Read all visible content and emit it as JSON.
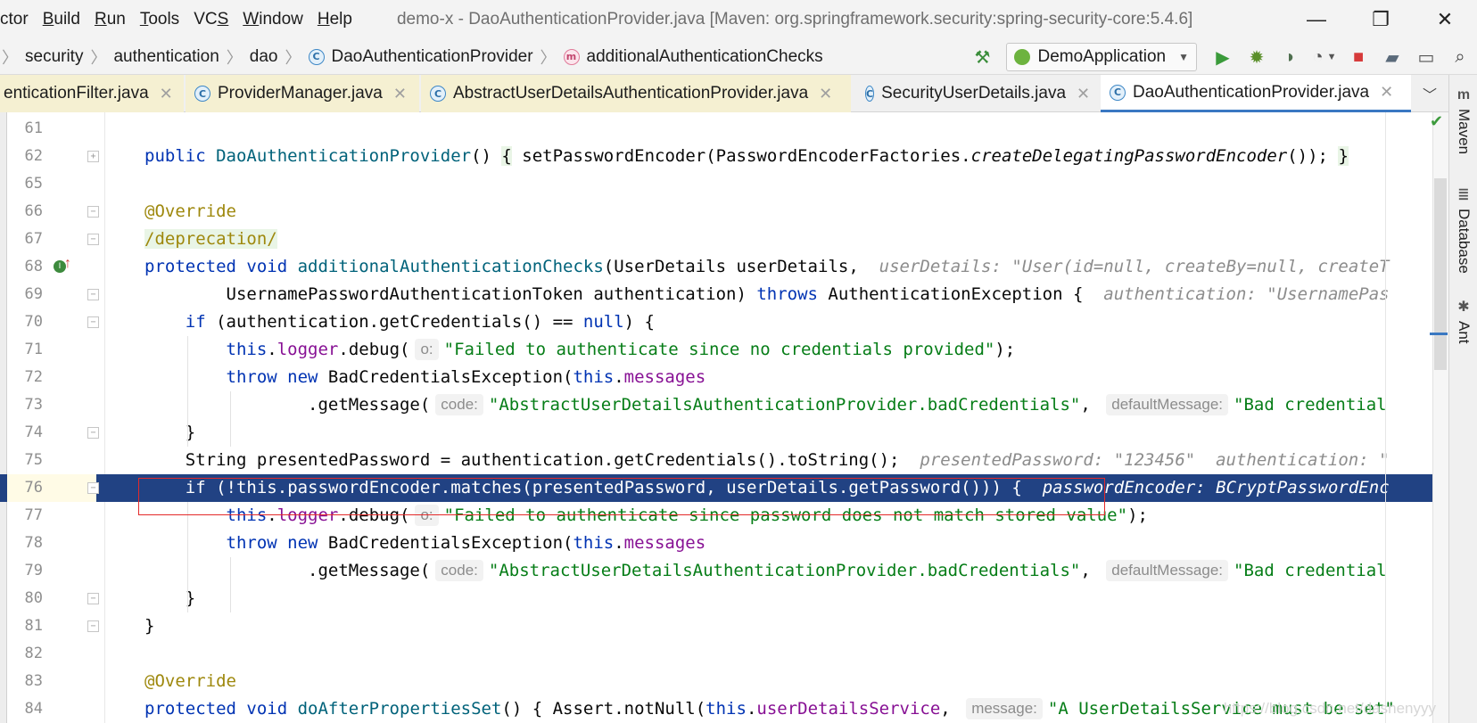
{
  "window": {
    "menu": [
      {
        "pre": "",
        "mn": "",
        "post": "ctor"
      },
      {
        "pre": "",
        "mn": "B",
        "post": "uild"
      },
      {
        "pre": "",
        "mn": "R",
        "post": "un"
      },
      {
        "pre": "",
        "mn": "T",
        "post": "ools"
      },
      {
        "pre": "VC",
        "mn": "S",
        "post": ""
      },
      {
        "pre": "",
        "mn": "W",
        "post": "indow"
      },
      {
        "pre": "",
        "mn": "H",
        "post": "elp"
      }
    ],
    "title": "demo-x - DaoAuthenticationProvider.java [Maven: org.springframework.security:spring-security-core:5.4.6]",
    "minimize": "—",
    "restore": "❐",
    "close": "✕"
  },
  "breadcrumbs": [
    "security",
    "authentication",
    "dao",
    "DaoAuthenticationProvider",
    "additionalAuthenticationChecks"
  ],
  "run_config": "DemoApplication",
  "tabs": [
    {
      "label": "enticationFilter.java",
      "style": "tan"
    },
    {
      "label": "ProviderManager.java",
      "style": "tan"
    },
    {
      "label": "AbstractUserDetailsAuthenticationProvider.java",
      "style": "tan"
    },
    {
      "label": "SecurityUserDetails.java",
      "style": "plain"
    },
    {
      "label": "DaoAuthenticationProvider.java",
      "style": "active"
    }
  ],
  "right_tools": [
    "Maven",
    "Database",
    "Ant"
  ],
  "editor": {
    "selected_line": "76",
    "lines": [
      {
        "n": "61",
        "html": ""
      },
      {
        "n": "62",
        "html": "<span class=\"kw\">public</span> <span class=\"fn\">DaoAuthenticationProvider</span>() <span class=\"brace-hl\">{</span> setPasswordEncoder(PasswordEncoderFactories.<span class=\"it\">createDelegatingPasswordEncoder</span>()); <span class=\"brace-hl\">}</span>"
      },
      {
        "n": "65",
        "html": ""
      },
      {
        "n": "66",
        "html": "<span class=\"ann\">@Override</span>"
      },
      {
        "n": "67",
        "html": "<span class=\"ann depr\">/deprecation/</span>"
      },
      {
        "n": "68",
        "html": "<span class=\"kw\">protected void</span> <span class=\"fn\">additionalAuthenticationChecks</span>(UserDetails userDetails,  <span class=\"hint\">userDetails: \"User(id=null, createBy=null, createT</span>"
      },
      {
        "n": "69",
        "html": "        UsernamePasswordAuthenticationToken authentication) <span class=\"kw\">throws</span> AuthenticationException {  <span class=\"hint\">authentication: \"UsernamePas</span>"
      },
      {
        "n": "70",
        "html": "    <span class=\"kw\">if</span> (authentication.getCredentials() == <span class=\"kw\">null</span>) {"
      },
      {
        "n": "71",
        "html": "        <span class=\"kw\">this</span>.<span class=\"fld\">logger</span>.debug(<span class=\"pill\">o:</span><span class=\"str\">\"Failed to authenticate since no credentials provided\"</span>);"
      },
      {
        "n": "72",
        "html": "        <span class=\"kw\">throw new</span> BadCredentialsException(<span class=\"kw\">this</span>.<span class=\"fld\">messages</span>"
      },
      {
        "n": "73",
        "html": "                .getMessage(<span class=\"pill\">code:</span><span class=\"str\">\"AbstractUserDetailsAuthenticationProvider.badCredentials\"</span>, <span class=\"pill\">defaultMessage:</span><span class=\"str\">\"Bad credential</span>"
      },
      {
        "n": "74",
        "html": "    }"
      },
      {
        "n": "75",
        "html": "    String presentedPassword = authentication.getCredentials().toString();  <span class=\"hint\">presentedPassword: \"123456\"  authentication: \"</span>"
      },
      {
        "n": "76",
        "html": "    <span class=\"kw\">if</span> (!<span class=\"kw\">this</span>.<span class=\"fld\">passwordEncoder</span>.matches(presentedPassword, userDetails.getPassword())) {  <span class=\"hint\">passwordEncoder: BCryptPasswordEnc</span>"
      },
      {
        "n": "77",
        "html": "        <span class=\"kw\">this</span>.<span class=\"fld\">logger</span>.debug(<span class=\"pill\">o:</span><span class=\"str\">\"Failed to authenticate since password does not match stored value\"</span>);"
      },
      {
        "n": "78",
        "html": "        <span class=\"kw\">throw new</span> BadCredentialsException(<span class=\"kw\">this</span>.<span class=\"fld\">messages</span>"
      },
      {
        "n": "79",
        "html": "                .getMessage(<span class=\"pill\">code:</span><span class=\"str\">\"AbstractUserDetailsAuthenticationProvider.badCredentials\"</span>, <span class=\"pill\">defaultMessage:</span><span class=\"str\">\"Bad credential</span>"
      },
      {
        "n": "80",
        "html": "    }"
      },
      {
        "n": "81",
        "html": "}"
      },
      {
        "n": "82",
        "html": ""
      },
      {
        "n": "83",
        "html": "<span class=\"ann\">@Override</span>"
      },
      {
        "n": "84",
        "html": "<span class=\"kw\">protected void</span> <span class=\"fn\">doAfterPropertiesSet</span>() { Assert.notNull(<span class=\"kw\">this</span>.<span class=\"fld\">userDetailsService</span>, <span class=\"pill\">message:</span><span class=\"str\">\"A UserDetailsService must be set\"</span>"
      }
    ]
  },
  "watermark": "https://blog.csdn.net/dashenyyy"
}
